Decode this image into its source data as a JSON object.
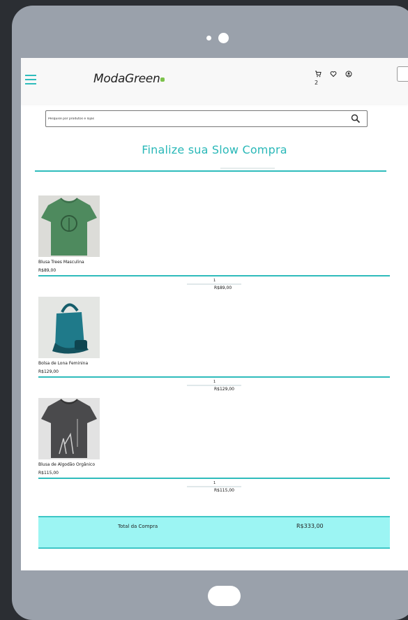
{
  "header": {
    "logo": "ModaGreen",
    "cart_count": "2",
    "icons": [
      "menu-icon",
      "cart-icon",
      "heart-icon",
      "user-icon"
    ]
  },
  "search": {
    "placeholder": "Pesquise por produtos e lojas"
  },
  "page": {
    "title": "Finalize sua Slow Compra"
  },
  "cart": {
    "items": [
      {
        "name": "Blusa Trees Masculina",
        "price": "R$89,00",
        "quantity": "1",
        "subtotal": "R$89,00"
      },
      {
        "name": "Bolsa de Lona Feminina",
        "price": "R$129,00",
        "quantity": "1",
        "subtotal": "R$129,00"
      },
      {
        "name": "Blusa de Algodão Orgânico",
        "price": "R$115,00",
        "quantity": "1",
        "subtotal": "R$115,00"
      }
    ],
    "total_label": "Total da Compra",
    "total_value": "R$333,00"
  },
  "colors": {
    "accent": "#2fbcbc",
    "total_bg": "#9cf5f3",
    "device": "#9aa1ab",
    "backdrop": "#2b2e33"
  }
}
